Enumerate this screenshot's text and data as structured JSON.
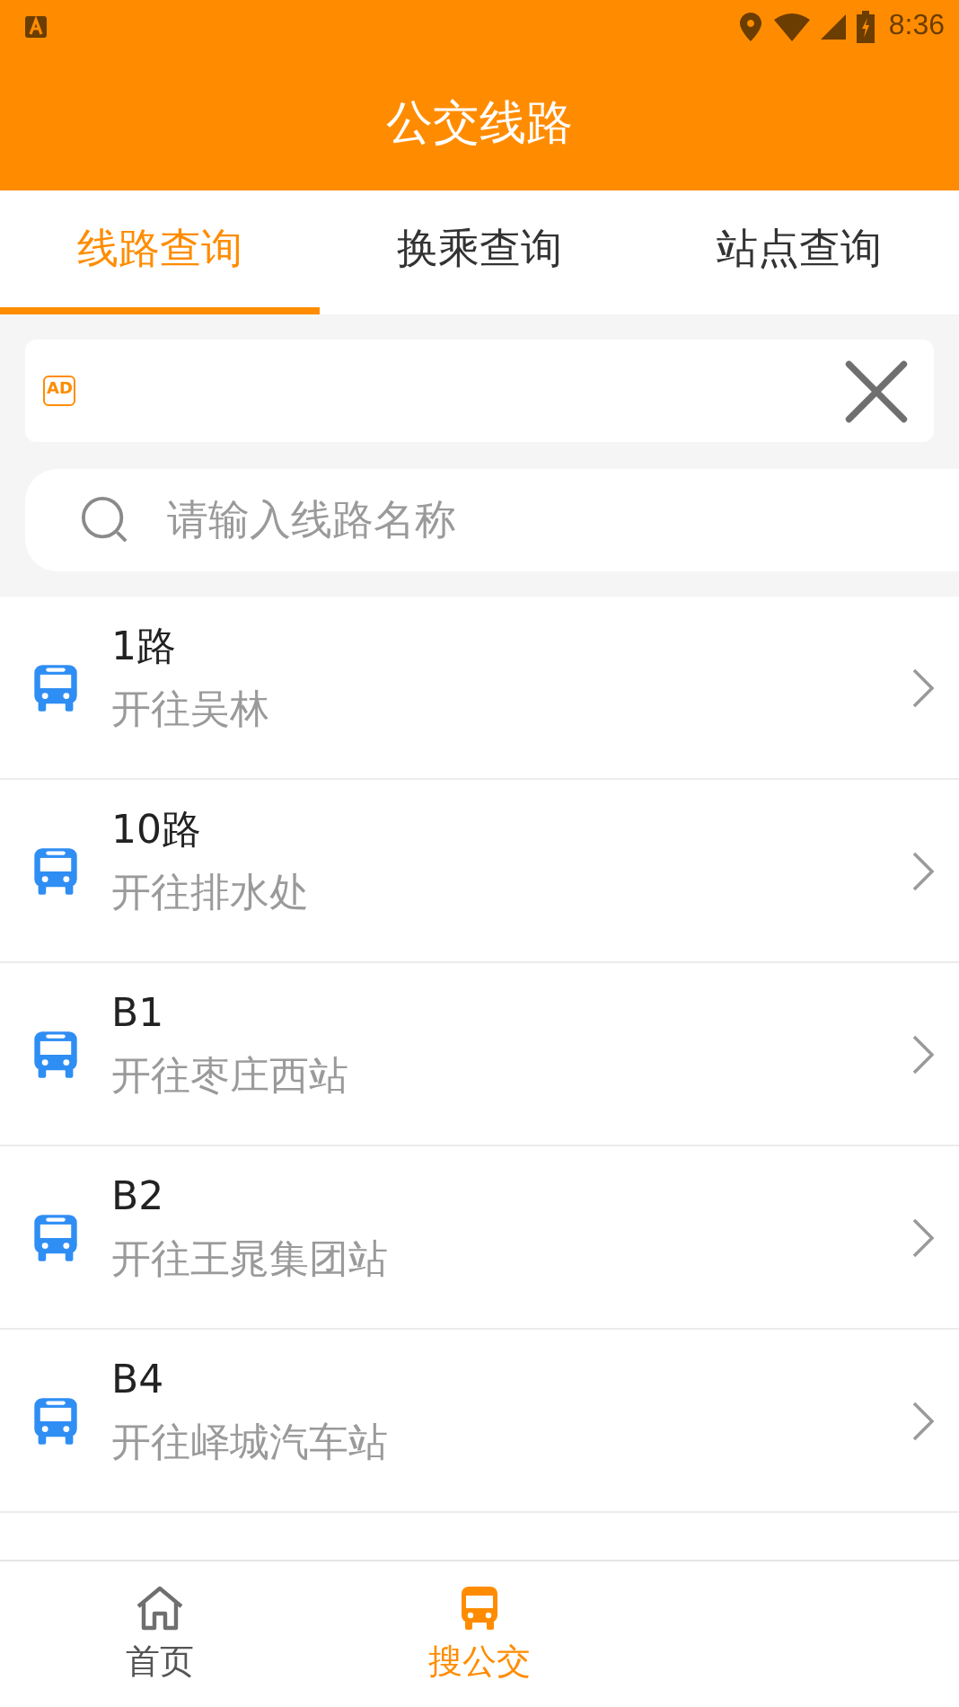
{
  "status_bar": {
    "time": "8:36"
  },
  "header": {
    "title": "公交线路"
  },
  "tabs": [
    {
      "label": "线路查询",
      "selected": true
    },
    {
      "label": "换乘查询",
      "selected": false
    },
    {
      "label": "站点查询",
      "selected": false
    }
  ],
  "ad": {
    "badge": "AD"
  },
  "search": {
    "placeholder": "请输入线路名称"
  },
  "routes": [
    {
      "name": "1路",
      "destination": "开往吴林"
    },
    {
      "name": "10路",
      "destination": "开往排水处"
    },
    {
      "name": "B1",
      "destination": "开往枣庄西站"
    },
    {
      "name": "B2",
      "destination": "开往王晁集团站"
    },
    {
      "name": "B4",
      "destination": "开往峄城汽车站"
    }
  ],
  "bottom_nav": [
    {
      "label": "首页",
      "kind": "home",
      "selected": false
    },
    {
      "label": "搜公交",
      "kind": "bus",
      "selected": true
    }
  ]
}
